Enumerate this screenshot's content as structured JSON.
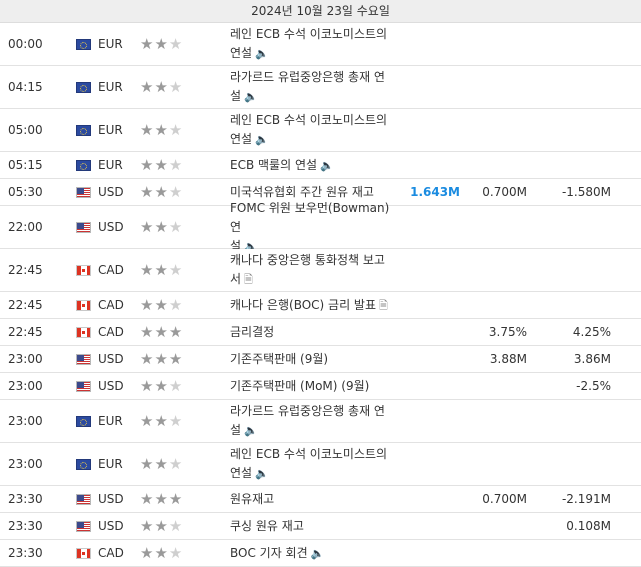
{
  "date_header": "2024년 10월 23일 수요일",
  "colors": {
    "actual_positive": "#1a8be0",
    "star_on": "#9a9a9a",
    "star_off": "#cfcfcf"
  },
  "rows": [
    {
      "time": "00:00",
      "country": "eu",
      "currency": "EUR",
      "importance": 2,
      "event_line1": "레인 ECB 수석 이코노미스트의",
      "event_line2": "연설",
      "icon": "speaker-icon",
      "actual": "",
      "forecast": "",
      "previous": ""
    },
    {
      "time": "04:15",
      "country": "eu",
      "currency": "EUR",
      "importance": 2,
      "event_line1": "라가르드 유럽중앙은행 총재 연",
      "event_line2": "설",
      "icon": "speaker-icon",
      "actual": "",
      "forecast": "",
      "previous": ""
    },
    {
      "time": "05:00",
      "country": "eu",
      "currency": "EUR",
      "importance": 2,
      "event_line1": "레인 ECB 수석 이코노미스트의",
      "event_line2": "연설",
      "icon": "speaker-icon",
      "actual": "",
      "forecast": "",
      "previous": ""
    },
    {
      "time": "05:15",
      "country": "eu",
      "currency": "EUR",
      "importance": 2,
      "event_line1": "ECB 맥룰의 연설",
      "event_line2": "",
      "icon": "speaker-icon",
      "actual": "",
      "forecast": "",
      "previous": ""
    },
    {
      "time": "05:30",
      "country": "us",
      "currency": "USD",
      "importance": 2,
      "event_line1": "미국석유협회 주간 원유 재고",
      "event_line2": "",
      "icon": "",
      "actual": "1.643M",
      "forecast": "0.700M",
      "previous": "-1.580M"
    },
    {
      "time": "22:00",
      "country": "us",
      "currency": "USD",
      "importance": 2,
      "event_line1": "FOMC 위원 보우먼(Bowman) 연",
      "event_line2": "설",
      "icon": "speaker-icon",
      "actual": "",
      "forecast": "",
      "previous": ""
    },
    {
      "time": "22:45",
      "country": "ca",
      "currency": "CAD",
      "importance": 2,
      "event_line1": "캐나다 중앙은행 통화정책 보고",
      "event_line2": "서",
      "icon": "document-icon",
      "actual": "",
      "forecast": "",
      "previous": ""
    },
    {
      "time": "22:45",
      "country": "ca",
      "currency": "CAD",
      "importance": 2,
      "event_line1": "캐나다 은행(BOC) 금리 발표",
      "event_line2": "",
      "icon": "document-icon",
      "actual": "",
      "forecast": "",
      "previous": ""
    },
    {
      "time": "22:45",
      "country": "ca",
      "currency": "CAD",
      "importance": 3,
      "event_line1": "금리결정",
      "event_line2": "",
      "icon": "",
      "actual": "",
      "forecast": "3.75%",
      "previous": "4.25%"
    },
    {
      "time": "23:00",
      "country": "us",
      "currency": "USD",
      "importance": 3,
      "event_line1": "기존주택판매 (9월)",
      "event_line2": "",
      "icon": "",
      "actual": "",
      "forecast": "3.88M",
      "previous": "3.86M"
    },
    {
      "time": "23:00",
      "country": "us",
      "currency": "USD",
      "importance": 2,
      "event_line1": "기존주택판매 (MoM) (9월)",
      "event_line2": "",
      "icon": "",
      "actual": "",
      "forecast": "",
      "previous": "-2.5%"
    },
    {
      "time": "23:00",
      "country": "eu",
      "currency": "EUR",
      "importance": 2,
      "event_line1": "라가르드 유럽중앙은행 총재 연",
      "event_line2": "설",
      "icon": "speaker-icon",
      "actual": "",
      "forecast": "",
      "previous": ""
    },
    {
      "time": "23:00",
      "country": "eu",
      "currency": "EUR",
      "importance": 2,
      "event_line1": "레인 ECB 수석 이코노미스트의",
      "event_line2": "연설",
      "icon": "speaker-icon",
      "actual": "",
      "forecast": "",
      "previous": ""
    },
    {
      "time": "23:30",
      "country": "us",
      "currency": "USD",
      "importance": 3,
      "event_line1": "원유재고",
      "event_line2": "",
      "icon": "",
      "actual": "",
      "forecast": "0.700M",
      "previous": "-2.191M"
    },
    {
      "time": "23:30",
      "country": "us",
      "currency": "USD",
      "importance": 2,
      "event_line1": "쿠싱 원유 재고",
      "event_line2": "",
      "icon": "",
      "actual": "",
      "forecast": "",
      "previous": "0.108M"
    },
    {
      "time": "23:30",
      "country": "ca",
      "currency": "CAD",
      "importance": 2,
      "event_line1": "BOC 기자 회견",
      "event_line2": "",
      "icon": "speaker-icon",
      "actual": "",
      "forecast": "",
      "previous": ""
    }
  ]
}
